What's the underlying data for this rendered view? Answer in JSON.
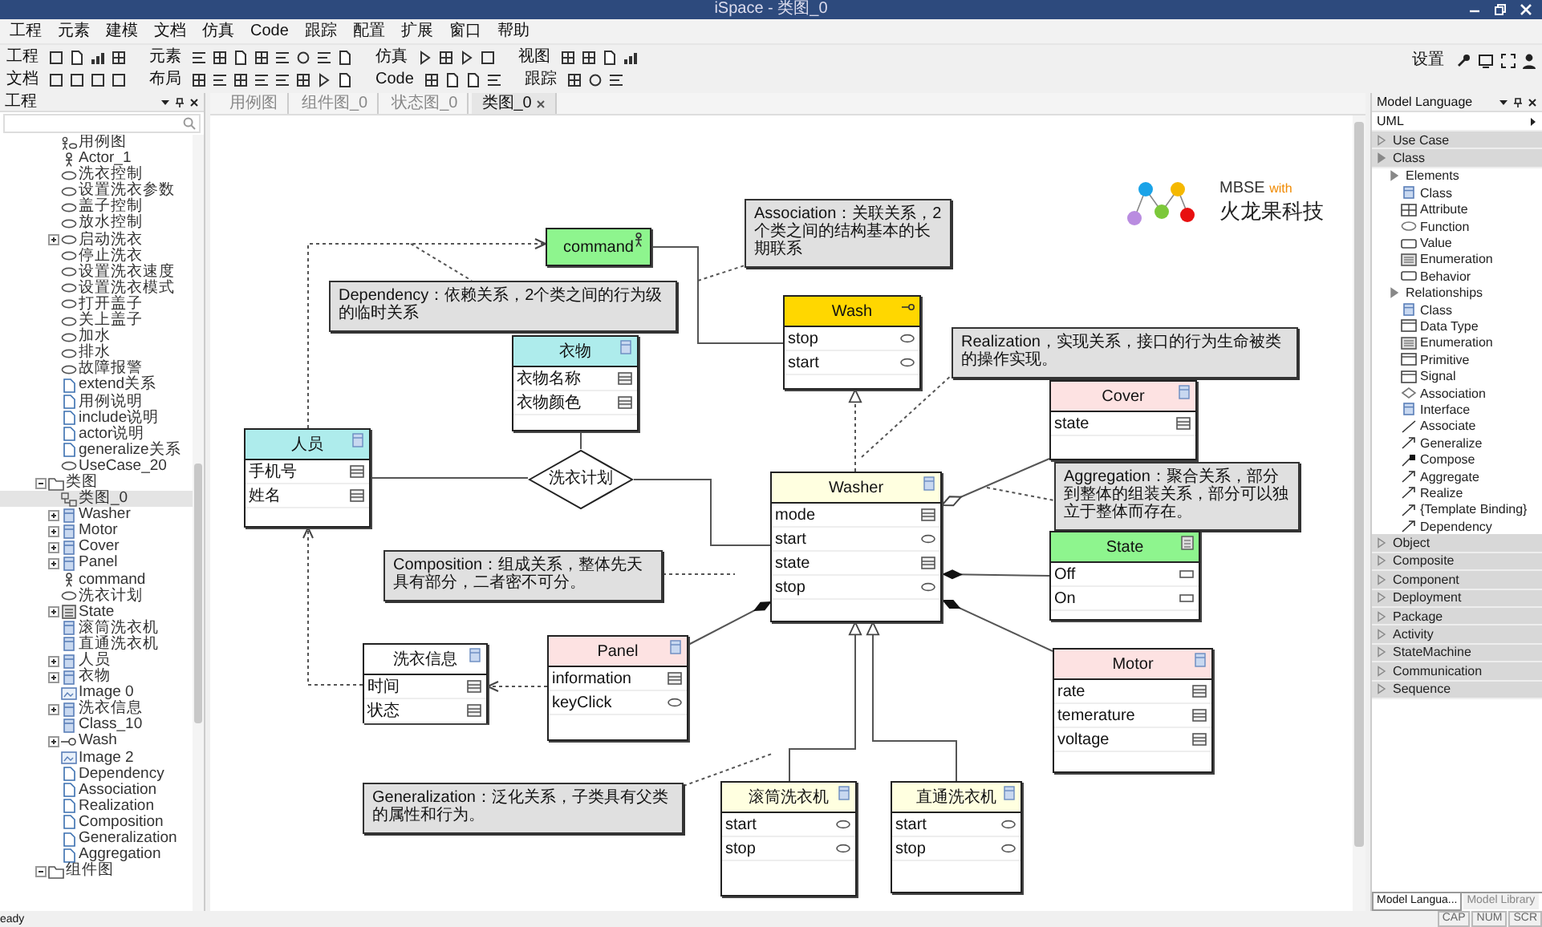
{
  "window": {
    "title": "iSpace - 类图_0"
  },
  "menu": [
    "工程",
    "元素",
    "建模",
    "文档",
    "仿真",
    "Code",
    "跟踪",
    "配置",
    "扩展",
    "窗口",
    "帮助"
  ],
  "toolbar": {
    "rows": [
      [
        {
          "label": "工程"
        },
        {
          "label": "元素"
        },
        {
          "label": "仿真"
        },
        {
          "label": "视图"
        }
      ],
      [
        {
          "label": "文档"
        },
        {
          "label": "布局"
        },
        {
          "label": "Code"
        },
        {
          "label": "跟踪"
        }
      ]
    ],
    "settings_label": "设置"
  },
  "project_tree": {
    "title": "工程",
    "scrolled": [
      {
        "label": "用例图",
        "kind": "usecase-diagram",
        "selected": false
      },
      {
        "label": "Actor_1",
        "kind": "actor",
        "selected": false
      },
      {
        "label": "洗衣控制",
        "kind": "usecase",
        "selected": false
      },
      {
        "label": "设置洗衣参数",
        "kind": "usecase",
        "selected": false
      },
      {
        "label": "盖子控制",
        "kind": "usecase",
        "selected": false
      },
      {
        "label": "放水控制",
        "kind": "usecase",
        "selected": false
      },
      {
        "label": "启动洗衣",
        "kind": "usecase",
        "selected": false,
        "expanded": false
      },
      {
        "label": "停止洗衣",
        "kind": "usecase",
        "selected": false
      },
      {
        "label": "设置洗衣速度",
        "kind": "usecase",
        "selected": false
      },
      {
        "label": "设置洗衣模式",
        "kind": "usecase",
        "selected": false
      },
      {
        "label": "打开盖子",
        "kind": "usecase",
        "selected": false
      },
      {
        "label": "关上盖子",
        "kind": "usecase",
        "selected": false
      },
      {
        "label": "加水",
        "kind": "usecase",
        "selected": false
      },
      {
        "label": "排水",
        "kind": "usecase",
        "selected": false
      },
      {
        "label": "故障报警",
        "kind": "usecase",
        "selected": false
      },
      {
        "label": "extend关系",
        "kind": "document",
        "selected": false
      },
      {
        "label": "用例说明",
        "kind": "document",
        "selected": false
      },
      {
        "label": "include说明",
        "kind": "document",
        "selected": false
      },
      {
        "label": "actor说明",
        "kind": "document",
        "selected": false
      },
      {
        "label": "generalize关系",
        "kind": "document",
        "selected": false
      },
      {
        "label": "UseCase_20",
        "kind": "usecase",
        "selected": false
      }
    ],
    "items": [
      {
        "label": "类图",
        "kind": "folder",
        "selected": false,
        "expanded": true,
        "children": [
          {
            "label": "类图_0",
            "kind": "class-diagram",
            "selected": true
          },
          {
            "label": "Washer",
            "kind": "class",
            "selected": false,
            "expanded": false
          },
          {
            "label": "Motor",
            "kind": "class",
            "selected": false,
            "expanded": false
          },
          {
            "label": "Cover",
            "kind": "class",
            "selected": false,
            "expanded": false
          },
          {
            "label": "Panel",
            "kind": "class",
            "selected": false,
            "expanded": false
          },
          {
            "label": "command",
            "kind": "actor",
            "selected": false
          },
          {
            "label": "洗衣计划",
            "kind": "usecase",
            "selected": false
          },
          {
            "label": "State",
            "kind": "enumeration",
            "selected": false,
            "expanded": false
          },
          {
            "label": "滚筒洗衣机",
            "kind": "class",
            "selected": false
          },
          {
            "label": "直通洗衣机",
            "kind": "class",
            "selected": false
          },
          {
            "label": "人员",
            "kind": "class",
            "selected": false,
            "expanded": false
          },
          {
            "label": "衣物",
            "kind": "class",
            "selected": false,
            "expanded": false
          },
          {
            "label": "Image 0",
            "kind": "image",
            "selected": false
          },
          {
            "label": "洗衣信息",
            "kind": "class",
            "selected": false,
            "expanded": false
          },
          {
            "label": "Class_10",
            "kind": "class",
            "selected": false
          },
          {
            "label": "Wash",
            "kind": "interface",
            "selected": false,
            "expanded": false
          },
          {
            "label": "Image 2",
            "kind": "image",
            "selected": false
          },
          {
            "label": "Dependency",
            "kind": "document",
            "selected": false
          },
          {
            "label": "Association",
            "kind": "document",
            "selected": false
          },
          {
            "label": "Realization",
            "kind": "document",
            "selected": false
          },
          {
            "label": "Composition",
            "kind": "document",
            "selected": false
          },
          {
            "label": "Generalization",
            "kind": "document",
            "selected": false
          },
          {
            "label": "Aggregation",
            "kind": "document",
            "selected": false
          }
        ]
      },
      {
        "label": "组件图",
        "kind": "folder",
        "selected": false,
        "expanded": true
      }
    ]
  },
  "editor_tabs": [
    {
      "label": "用例图",
      "selected": false
    },
    {
      "label": "组件图_0",
      "selected": false
    },
    {
      "label": "状态图_0",
      "selected": false
    },
    {
      "label": "类图_0",
      "selected": true
    }
  ],
  "diagram": {
    "notes": [
      {
        "text": "Association：关联关系，2个类之间的结构基本的长期联系"
      },
      {
        "text": "Dependency：依赖关系，2个类之间的行为级的临时关系"
      },
      {
        "text": "Realization，实现关系，接口的行为生命被类的操作实现。"
      },
      {
        "text": "Aggregation：聚合关系，部分到整体的组装关系，部分可以独立于整体而存在。"
      },
      {
        "text": "Composition：组成关系，整体先天具有部分，二者密不可分。"
      },
      {
        "text": "Generalization：泛化关系，子类具有父类的属性和行为。"
      }
    ],
    "nodes": [
      {
        "name": "command",
        "kind": "actor",
        "color": "#8ef58e"
      },
      {
        "name": "Wash",
        "kind": "interface",
        "color": "#ffd700",
        "rows": [
          {
            "label": "stop",
            "kind": "operation"
          },
          {
            "label": "start",
            "kind": "operation"
          }
        ]
      },
      {
        "name": "衣物",
        "kind": "class",
        "color": "#aeecec",
        "rows": [
          {
            "label": "衣物名称",
            "kind": "attribute"
          },
          {
            "label": "衣物颜色",
            "kind": "attribute"
          }
        ]
      },
      {
        "name": "Cover",
        "kind": "class",
        "color": "#fde2e2",
        "rows": [
          {
            "label": "state",
            "kind": "attribute"
          }
        ]
      },
      {
        "name": "人员",
        "kind": "class",
        "color": "#aeecec",
        "rows": [
          {
            "label": "手机号",
            "kind": "attribute"
          },
          {
            "label": "姓名",
            "kind": "attribute"
          }
        ]
      },
      {
        "name": "Washer",
        "kind": "class",
        "color": "#ffffe0",
        "rows": [
          {
            "label": "mode",
            "kind": "attribute"
          },
          {
            "label": "start",
            "kind": "operation"
          },
          {
            "label": "state",
            "kind": "attribute"
          },
          {
            "label": "stop",
            "kind": "operation"
          }
        ]
      },
      {
        "name": "State",
        "kind": "enumeration",
        "color": "#8ef58e",
        "rows": [
          {
            "label": "Off",
            "kind": "literal"
          },
          {
            "label": "On",
            "kind": "literal"
          }
        ]
      },
      {
        "name": "洗衣信息",
        "kind": "class",
        "color": "#ffffff",
        "rows": [
          {
            "label": "时间",
            "kind": "attribute"
          },
          {
            "label": "状态",
            "kind": "attribute"
          }
        ]
      },
      {
        "name": "Panel",
        "kind": "class",
        "color": "#fde2e2",
        "rows": [
          {
            "label": "information",
            "kind": "attribute"
          },
          {
            "label": "keyClick",
            "kind": "operation"
          }
        ]
      },
      {
        "name": "Motor",
        "kind": "class",
        "color": "#fde2e2",
        "rows": [
          {
            "label": "rate",
            "kind": "attribute"
          },
          {
            "label": "temerature",
            "kind": "attribute"
          },
          {
            "label": "voltage",
            "kind": "attribute"
          }
        ]
      },
      {
        "name": "滚筒洗衣机",
        "kind": "class",
        "color": "#ffffe0",
        "rows": [
          {
            "label": "start",
            "kind": "operation"
          },
          {
            "label": "stop",
            "kind": "operation"
          }
        ]
      },
      {
        "name": "直通洗衣机",
        "kind": "class",
        "color": "#ffffe0",
        "rows": [
          {
            "label": "start",
            "kind": "operation"
          },
          {
            "label": "stop",
            "kind": "operation"
          }
        ]
      }
    ],
    "association_class": {
      "label": "洗衣计划"
    },
    "logo": {
      "title": "MBSE",
      "with": "with",
      "company": "火龙果科技"
    }
  },
  "model_language": {
    "title": "Model Language",
    "profile": "UML",
    "sections": [
      {
        "label": "Use Case",
        "expanded": false
      },
      {
        "label": "Class",
        "expanded": true,
        "children": [
          {
            "label": "Elements",
            "expanded": true,
            "children": [
              {
                "label": "Class",
                "kind": "class"
              },
              {
                "label": "Attribute",
                "kind": "attribute"
              },
              {
                "label": "Function",
                "kind": "function"
              },
              {
                "label": "Value",
                "kind": "value"
              },
              {
                "label": "Enumeration",
                "kind": "enumeration"
              },
              {
                "label": "Behavior",
                "kind": "behavior"
              }
            ]
          },
          {
            "label": "Relationships",
            "expanded": true,
            "children": [
              {
                "label": "Class",
                "kind": "class"
              },
              {
                "label": "Data Type",
                "kind": "datatype"
              },
              {
                "label": "Enumeration",
                "kind": "enumeration"
              },
              {
                "label": "Primitive",
                "kind": "datatype"
              },
              {
                "label": "Signal",
                "kind": "datatype"
              },
              {
                "label": "Association",
                "kind": "association"
              },
              {
                "label": "Interface",
                "kind": "class"
              },
              {
                "label": "Associate",
                "kind": "line"
              },
              {
                "label": "Generalize",
                "kind": "arrow"
              },
              {
                "label": "Compose",
                "kind": "compose"
              },
              {
                "label": "Aggregate",
                "kind": "arrow"
              },
              {
                "label": "Realize",
                "kind": "arrow"
              },
              {
                "label": "{Template Binding}",
                "kind": "arrow"
              },
              {
                "label": "Dependency",
                "kind": "arrow"
              }
            ]
          }
        ]
      },
      {
        "label": "Object",
        "expanded": false
      },
      {
        "label": "Composite",
        "expanded": false
      },
      {
        "label": "Component",
        "expanded": false
      },
      {
        "label": "Deployment",
        "expanded": false
      },
      {
        "label": "Package",
        "expanded": false
      },
      {
        "label": "Activity",
        "expanded": false
      },
      {
        "label": "StateMachine",
        "expanded": false
      },
      {
        "label": "Communication",
        "expanded": false
      },
      {
        "label": "Sequence",
        "expanded": false
      }
    ],
    "tabs": [
      {
        "label": "Model Langua...",
        "selected": true
      },
      {
        "label": "Model Library",
        "selected": false
      }
    ]
  },
  "status_bar": {
    "text": "eady",
    "indicators": [
      "CAP",
      "NUM",
      "SCR"
    ]
  }
}
